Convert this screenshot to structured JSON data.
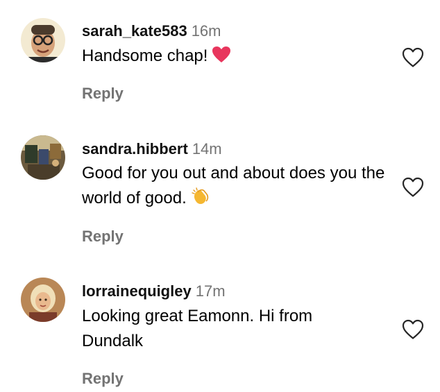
{
  "comments": [
    {
      "username": "sarah_kate583",
      "time": "16m",
      "text": "Handsome chap!",
      "emoji": "heart-emoji",
      "reply_label": "Reply",
      "avatar_colors": [
        "#f2e6c9",
        "#d9a47c"
      ]
    },
    {
      "username": "sandra.hibbert",
      "time": "14m",
      "text": "Good for you out and about does you the world of good.",
      "emoji": "clapping-hands-emoji",
      "reply_label": "Reply",
      "avatar_colors": [
        "#5a6b4e",
        "#8a7a5c"
      ]
    },
    {
      "username": "lorrainequigley",
      "time": "17m",
      "text": "Looking great Eamonn. Hi from Dundalk",
      "emoji": "",
      "reply_label": "Reply",
      "avatar_colors": [
        "#c99a6a",
        "#e8d4b0"
      ]
    }
  ],
  "colors": {
    "heart_emoji": "#e8365d",
    "clap_emoji": "#f5b731",
    "secondary_text": "#737373",
    "like_outline": "#262626"
  },
  "icons": {
    "like": "heart-outline-icon"
  }
}
